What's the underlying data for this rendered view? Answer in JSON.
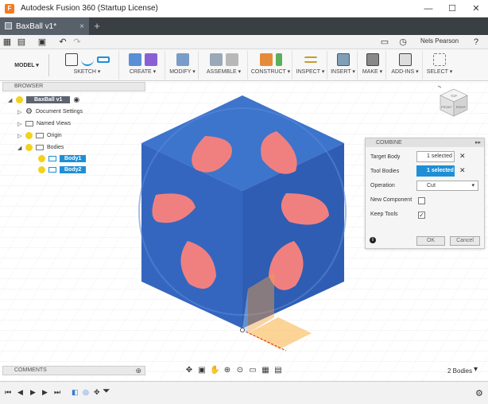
{
  "window": {
    "title": "Autodesk Fusion 360 (Startup License)",
    "minimize": "—",
    "maximize": "☐",
    "close": "✕"
  },
  "tabs": [
    {
      "label": "BaxBall v1*",
      "close": "×"
    }
  ],
  "new_tab": "+",
  "quickbar": {
    "user_name": "Nels Pearson"
  },
  "ribbon": {
    "workspace": "MODEL ▾",
    "groups": [
      {
        "label": "SKETCH ▾"
      },
      {
        "label": "CREATE ▾"
      },
      {
        "label": "MODIFY ▾"
      },
      {
        "label": "ASSEMBLE ▾"
      },
      {
        "label": "CONSTRUCT ▾"
      },
      {
        "label": "INSPECT ▾"
      },
      {
        "label": "INSERT ▾"
      },
      {
        "label": "MAKE ▾"
      },
      {
        "label": "ADD-INS ▾"
      },
      {
        "label": "SELECT ▾"
      }
    ]
  },
  "browser": {
    "title": "BROWSER",
    "root": "BaxBall v1",
    "items": [
      {
        "label": "Document Settings"
      },
      {
        "label": "Named Views"
      },
      {
        "label": "Origin"
      },
      {
        "label": "Bodies"
      },
      {
        "label": "Body1"
      },
      {
        "label": "Body2"
      }
    ]
  },
  "viewcube": {
    "top": "TOP",
    "front": "FRONT",
    "right": "RIGHT"
  },
  "combine": {
    "title": "COMBINE",
    "target_body_label": "Target Body",
    "target_body_value": "1 selected",
    "tool_bodies_label": "Tool Bodies",
    "tool_bodies_value": "1 selected",
    "operation_label": "Operation",
    "operation_value": "Cut",
    "new_component_label": "New Component",
    "new_component_checked": false,
    "keep_tools_label": "Keep Tools",
    "keep_tools_checked": true,
    "ok": "OK",
    "cancel": "Cancel"
  },
  "comments": {
    "title": "COMMENTS"
  },
  "status": {
    "bodies_count": "2 Bodies"
  },
  "colors": {
    "cube_face": "#3a6fc6",
    "cutout": "#f08080",
    "selection": "#1e8fd6",
    "accent": "#f47b20"
  }
}
